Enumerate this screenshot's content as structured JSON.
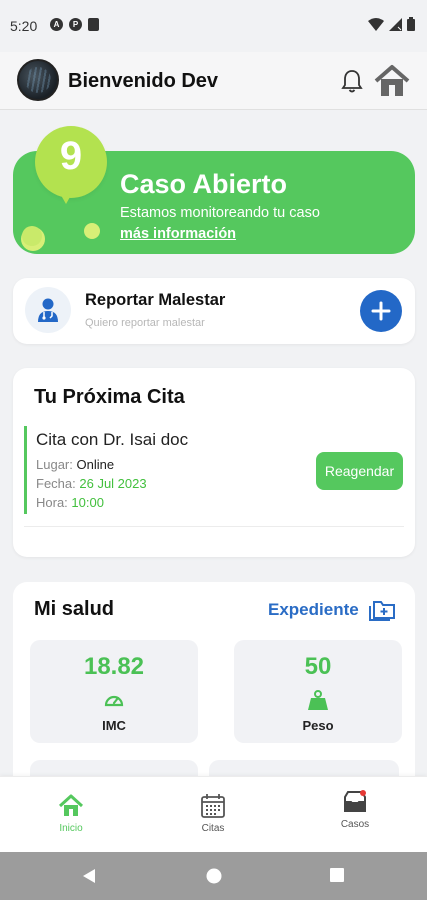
{
  "status_bar": {
    "time": "5:20",
    "left_icons": [
      "a-circle-icon",
      "p-circle-icon",
      "sd-card-icon"
    ],
    "right_icons": [
      "wifi-icon",
      "signal-icon",
      "battery-icon"
    ]
  },
  "header": {
    "welcome": "Bienvenido Dev"
  },
  "case_banner": {
    "number": "9",
    "title": "Caso Abierto",
    "subtitle": "Estamos monitoreando tu caso",
    "link": "más información",
    "color": "#55c85e"
  },
  "report": {
    "title": "Reportar Malestar",
    "subtitle": "Quiero reportar malestar",
    "accent": "#2368c7"
  },
  "appointment": {
    "title": "Tu Próxima Cita",
    "doctor": "Cita con Dr. Isai doc",
    "place_label": "Lugar:",
    "place_value": "Online",
    "date_label": "Fecha:",
    "date_value": "26 Jul 2023",
    "time_label": "Hora:",
    "time_value": "10:00",
    "reschedule": "Reagendar"
  },
  "health": {
    "title": "Mi salud",
    "record_link": "Expediente",
    "stats": [
      {
        "value": "18.82",
        "label": "IMC",
        "icon": "gauge-icon"
      },
      {
        "value": "50",
        "label": "Peso",
        "icon": "weight-icon"
      }
    ]
  },
  "nav": {
    "items": [
      {
        "label": "Inicio",
        "icon": "home-icon",
        "active": true
      },
      {
        "label": "Citas",
        "icon": "calendar-icon",
        "active": false
      },
      {
        "label": "Casos",
        "icon": "inbox-icon",
        "active": false
      }
    ]
  }
}
